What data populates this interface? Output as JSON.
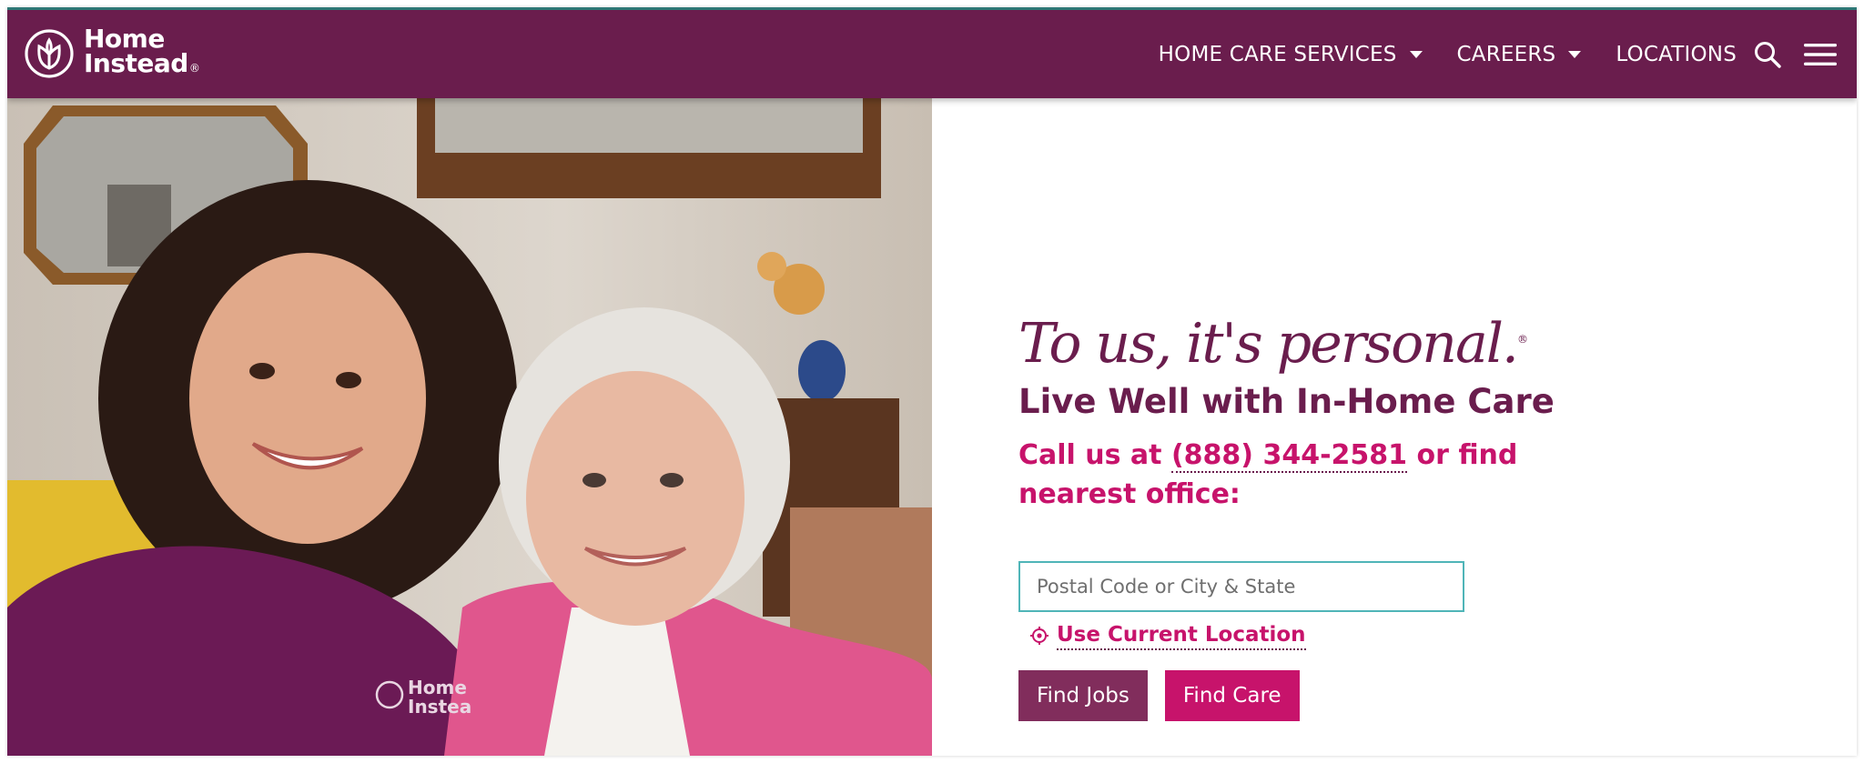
{
  "header": {
    "logo_line1": "Home",
    "logo_line2": "Instead",
    "logo_reg": "®",
    "nav": [
      {
        "label": "HOME CARE SERVICES",
        "has_dropdown": true
      },
      {
        "label": "CAREERS",
        "has_dropdown": true
      },
      {
        "label": "LOCATIONS",
        "has_dropdown": false
      }
    ],
    "search_icon": "search-icon",
    "menu_icon": "hamburger-menu-icon"
  },
  "hero": {
    "image_subject": "caregiver and senior woman smiling together",
    "shirt_logo_line1": "Home",
    "shirt_logo_line2": "Instea",
    "tagline": "To us, it's personal.",
    "tagline_reg": "®",
    "headline": "Live Well with In-Home Care",
    "call_prefix": "Call us at ",
    "phone": "(888) 344-2581",
    "call_suffix": " or find nearest office:",
    "location_input_value": "",
    "location_input_placeholder": "Postal Code or City & State",
    "use_location_icon": "crosshair-location-icon",
    "use_location_label": "Use Current Location",
    "find_jobs_label": "Find Jobs",
    "find_care_label": "Find Care"
  },
  "colors": {
    "brand_plum": "#6a1d4d",
    "brand_magenta": "#c7136b",
    "button_plum": "#812d5c",
    "input_border_teal": "#4fb5b8",
    "top_accent_teal": "#2f7a78"
  }
}
